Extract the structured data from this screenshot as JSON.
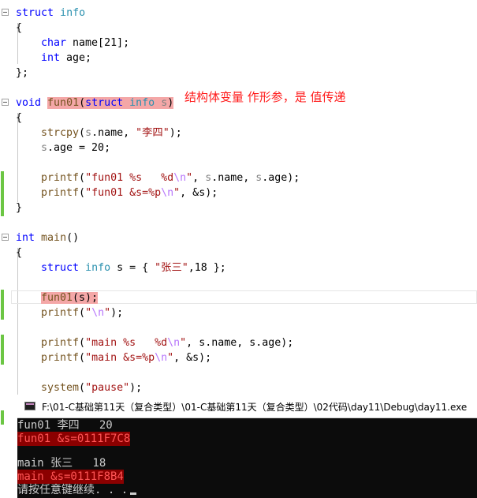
{
  "code": {
    "struct_kw": "struct",
    "struct_name": "info",
    "open_brace": "{",
    "close_brace": "}",
    "close_brace_semi": "};",
    "char_kw": "char",
    "member_name": " name[21];",
    "int_kw": "int",
    "member_age": " age;",
    "void_kw": "void",
    "fun01": "fun01",
    "s_param": "s",
    "strcpy": "strcpy",
    "s_var": "s",
    "dot_name": ".name, ",
    "str_lisi": "\"李四\"",
    "semi_close": ");",
    "dot_age_assign": ".age = 20;",
    "printf": "printf",
    "fmt1_a": "\"fun01 %s   %d",
    "esc_n": "\\n",
    "quote": "\"",
    "args_name_age": ".name, ",
    "dot_age": ".age);",
    "fmt2_a": "\"fun01 &s=%p",
    "amp_s": ", &s);",
    "main_fn": "main",
    "main_sig": "()",
    "eq_brace": " = { ",
    "str_zhangsan": "\"张三\"",
    "init_tail": ",18 };",
    "call_args": "(s);",
    "fmt3": "\"main %s   %d",
    "fmt4": "\"main &s=%p",
    "system_fn": "system",
    "pause_str": "\"pause\"",
    "open_paren": "(",
    "comma_space": ", "
  },
  "annotation": "结构体变量 作形参，是 值传递",
  "console": {
    "title": "F:\\01-C基础第11天（复合类型）\\01-C基础第11天（复合类型）\\02代码\\day11\\Debug\\day11.exe",
    "lines": [
      "fun01 李四   20",
      "fun01 &s=0111F7C8",
      "",
      "main 张三   18",
      "main &s=0111F8B4",
      "请按任意键继续. . ."
    ]
  },
  "colors": {
    "keyword": "#0000ff",
    "type": "#2b91af",
    "function": "#74531f",
    "string": "#a31515",
    "escape": "#b776fb",
    "highlight": "#f4a7a7",
    "annotation": "#ff1a1a",
    "change_bar": "#6cc644"
  }
}
